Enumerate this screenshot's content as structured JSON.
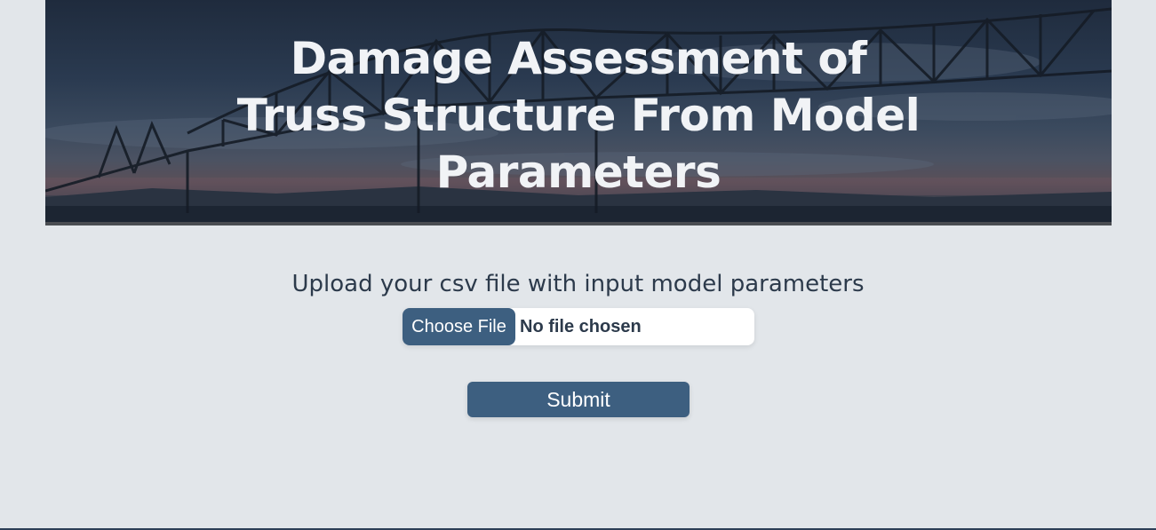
{
  "hero": {
    "title": "Damage Assessment of Truss Structure From Model Parameters",
    "background_image": "bridge-at-dusk"
  },
  "upload": {
    "label": "Upload your csv file with input model parameters",
    "choose_file_label": "Choose File",
    "file_status": "No file chosen"
  },
  "actions": {
    "submit_label": "Submit"
  },
  "colors": {
    "page_background": "#e2e6ea",
    "accent": "#3d5f80",
    "text_dark": "#2c3a4b",
    "hero_text": "#f1f3f6"
  }
}
